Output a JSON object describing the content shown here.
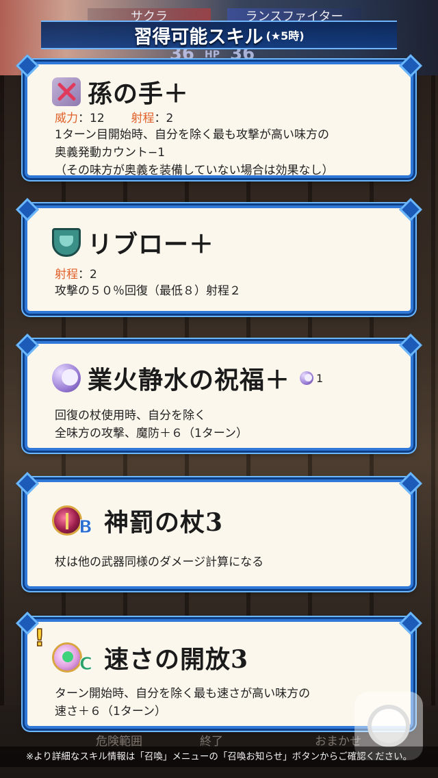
{
  "header": {
    "left_unit": "サクラ",
    "right_unit": "ランスファイター",
    "left_hp": "36",
    "hp_label": "HP",
    "right_hp": "36",
    "title": "習得可能スキル",
    "title_sub": "(★5時)"
  },
  "skills": [
    {
      "name": "孫の手＋",
      "icon": "crossed-swords-icon",
      "stats": [
        {
          "key": "威力",
          "value": "：12"
        },
        {
          "key": "射程",
          "value": "：2"
        }
      ],
      "desc": [
        "1ターン目開始時、自分を除く最も攻撃が高い味方の",
        "奥義発動カウント−1",
        "（その味方が奥義を装備していない場合は効果なし）"
      ]
    },
    {
      "name": "リブロー＋",
      "icon": "shield-icon",
      "stats": [
        {
          "key": "射程",
          "value": "：2"
        }
      ],
      "desc": [
        "攻撃の５０％回復（最低８）射程２"
      ]
    },
    {
      "name": "業火静水の祝福＋",
      "icon": "crescent-moon-icon",
      "cooldown": "1",
      "desc": [
        "回復の杖使用時、自分を除く",
        "全味方の攻撃、魔防＋６（1ターン）"
      ]
    },
    {
      "name": "神罰の杖3",
      "icon": "staff-icon",
      "slot": "B",
      "desc": [
        "杖は他の武器同様のダメージ計算になる"
      ]
    },
    {
      "name": "速さの開放3",
      "icon": "speed-icon",
      "slot": "C",
      "new_mark": "!",
      "desc": [
        "ターン開始時、自分を除く最も速さが高い味方の",
        "速さ＋６（1ターン）"
      ]
    }
  ],
  "footer": {
    "btn_danger": "危険範囲",
    "btn_end": "終了",
    "btn_auto": "おまかせ",
    "note": "※より詳細なスキル情報は「召喚」メニューの「召喚お知らせ」ボタンからご確認ください。"
  },
  "colors": {
    "card_bg": "#fbf7ec",
    "card_border": "#2f78d8",
    "stat_key": "#e0602a",
    "title_banner": "#123c82"
  }
}
